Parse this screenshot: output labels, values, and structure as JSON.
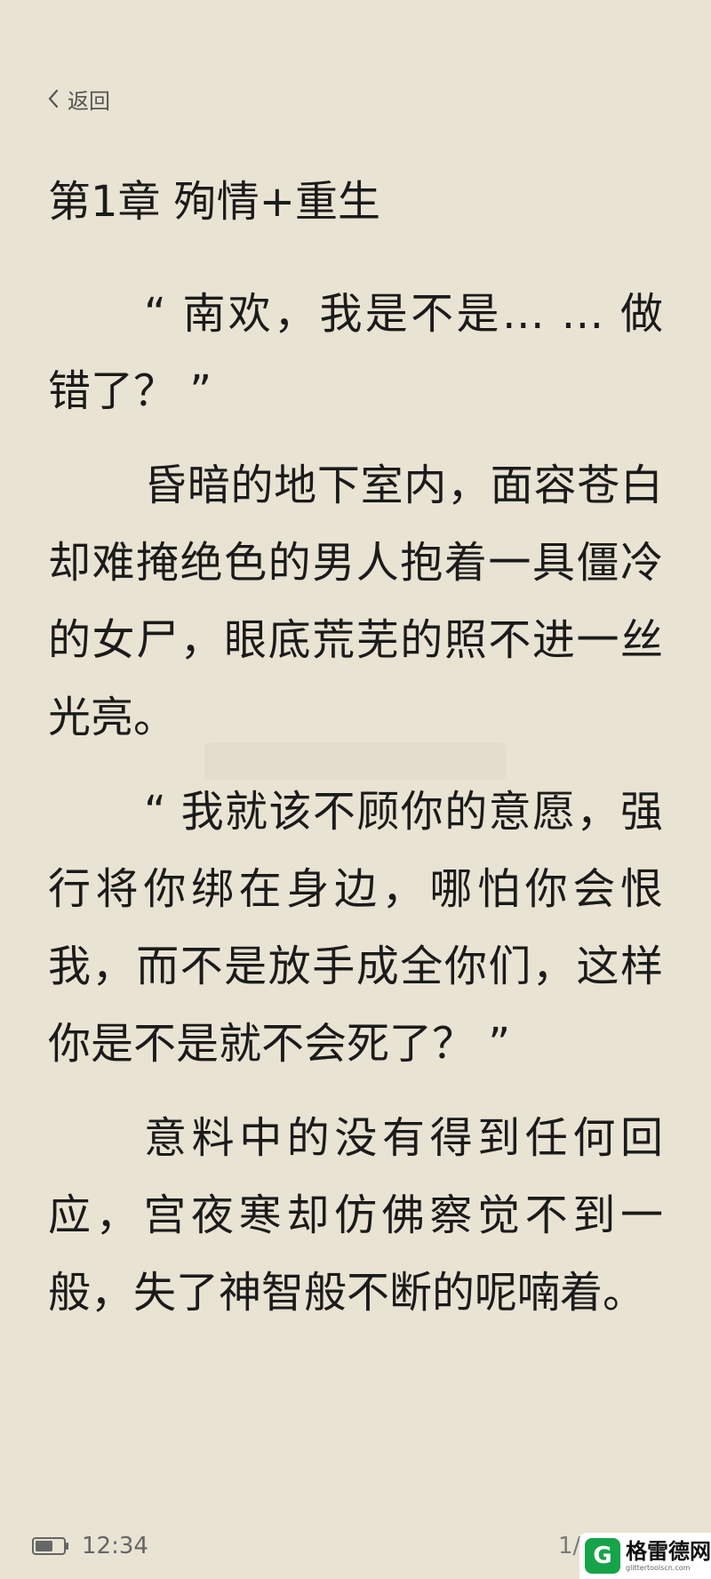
{
  "header": {
    "back_label": "返回"
  },
  "chapter": {
    "title": "第1章 殉情+重生"
  },
  "paragraphs": [
    "“ 南欢，我是不是… … 做错了？ ”",
    "昏暗的地下室内，面容苍白却难掩绝色的男人抱着一具僵冷的女尸，眼底荒芜的照不进一丝光亮。",
    "“ 我就该不顾你的意愿，强行将你绑在身边，哪怕你会恨我，而不是放手成全你们，这样你是不是就不会死了？ ”",
    "意料中的没有得到任何回应，宫夜寒却仿佛察觉不到一般，失了神智般不断的呢喃着。"
  ],
  "status": {
    "time": "12:34",
    "page": "1/4",
    "battery_level": "60%"
  },
  "logo": {
    "badge": "G",
    "name": "格雷德网",
    "site": "glittertoolscn.com"
  },
  "colors": {
    "background": "#e9e3d3",
    "text": "#1b1b1b",
    "logo_green": "#17a34a"
  }
}
